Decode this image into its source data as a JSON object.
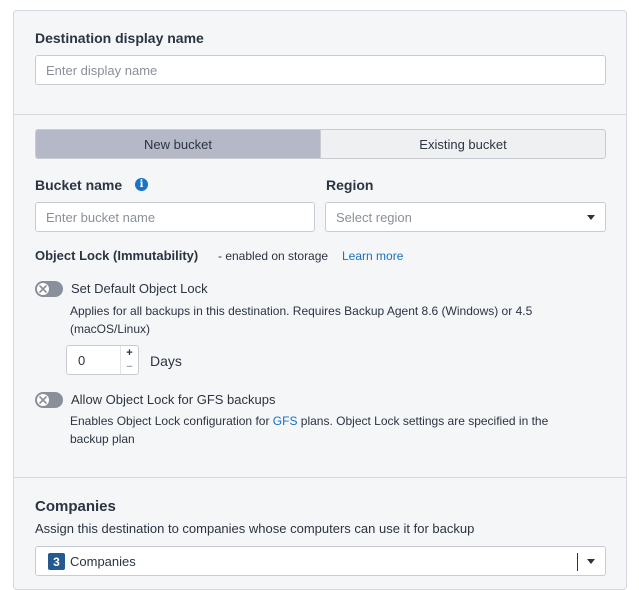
{
  "destination": {
    "label": "Destination display name",
    "placeholder": "Enter display name"
  },
  "bucket_mode": {
    "options": [
      "New bucket",
      "Existing bucket"
    ],
    "selected": "New bucket"
  },
  "bucket": {
    "label": "Bucket name",
    "placeholder": "Enter bucket name",
    "info_icon": "info-icon"
  },
  "region": {
    "label": "Region",
    "placeholder": "Select region"
  },
  "object_lock": {
    "title": "Object Lock (Immutability)",
    "note": "- enabled on storage",
    "learn_more": "Learn more",
    "default_lock": {
      "label": "Set Default Object Lock",
      "enabled": false,
      "desc_line1": "Applies for all backups in this destination. Requires Backup Agent 8.6 (Windows) or 4.5",
      "desc_line2": "(macOS/Linux)",
      "days_value": "0",
      "days_label": "Days",
      "plus": "+",
      "minus": "−"
    },
    "gfs_lock": {
      "label": "Allow Object Lock for GFS backups",
      "enabled": false,
      "desc_line1_pre": "Enables Object Lock configuration for ",
      "desc_line1_link": "GFS",
      "desc_line1_post": " plans. Object Lock settings are specified in the",
      "desc_line2": "backup plan"
    }
  },
  "companies": {
    "title": "Companies",
    "desc": "Assign this destination to companies whose computers can use it for backup",
    "count": "3",
    "value": "Companies"
  },
  "colors": {
    "accent": "#1a73c5",
    "segment_active": "#b5b8c6",
    "badge": "#245a8f"
  }
}
